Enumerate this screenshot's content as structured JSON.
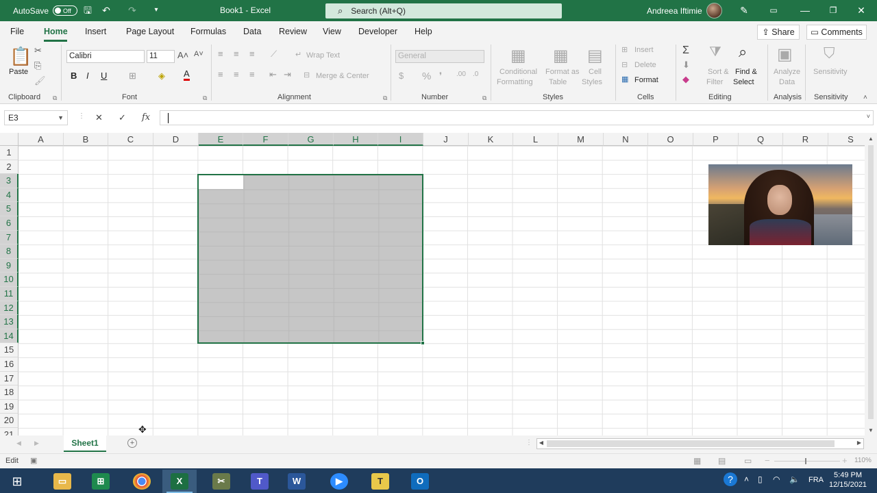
{
  "window": {
    "autosave_label": "AutoSave",
    "autosave_state": "Off",
    "title": "Book1 - Excel",
    "search_placeholder": "Search (Alt+Q)",
    "user_name": "Andreea Iftimie"
  },
  "tabs": [
    "File",
    "Home",
    "Insert",
    "Page Layout",
    "Formulas",
    "Data",
    "Review",
    "View",
    "Developer",
    "Help"
  ],
  "active_tab": "Home",
  "share_label": "Share",
  "comments_label": "Comments",
  "ribbon": {
    "clipboard": {
      "paste": "Paste",
      "label": "Clipboard"
    },
    "font": {
      "name": "Calibri",
      "size": "11",
      "label": "Font",
      "bold": "B",
      "italic": "I",
      "underline": "U"
    },
    "alignment": {
      "wrap_text": "Wrap Text",
      "merge_center": "Merge & Center",
      "label": "Alignment"
    },
    "number": {
      "format": "General",
      "label": "Number",
      "currency": "$",
      "percent": "%"
    },
    "styles": {
      "conditional_1": "Conditional",
      "conditional_2": "Formatting",
      "format_table_1": "Format as",
      "format_table_2": "Table",
      "cell_styles_1": "Cell",
      "cell_styles_2": "Styles",
      "label": "Styles"
    },
    "cells": {
      "insert": "Insert",
      "delete": "Delete",
      "format": "Format",
      "label": "Cells"
    },
    "editing": {
      "sort_1": "Sort &",
      "sort_2": "Filter",
      "find_1": "Find &",
      "find_2": "Select",
      "label": "Editing"
    },
    "analysis": {
      "analyze_1": "Analyze",
      "analyze_2": "Data",
      "label": "Analysis"
    },
    "sensitivity": {
      "button": "Sensitivity",
      "label": "Sensitivity"
    }
  },
  "formula_bar": {
    "name_box": "E3",
    "cancel": "✕",
    "enter": "✓",
    "fx": "fx",
    "value": ""
  },
  "grid": {
    "columns": [
      "A",
      "B",
      "C",
      "D",
      "E",
      "F",
      "G",
      "H",
      "I",
      "J",
      "K",
      "L",
      "M",
      "N",
      "O",
      "P",
      "Q",
      "R",
      "S"
    ],
    "rows": [
      "1",
      "2",
      "3",
      "4",
      "5",
      "6",
      "7",
      "8",
      "9",
      "10",
      "11",
      "12",
      "13",
      "14",
      "15",
      "16",
      "17",
      "18",
      "19",
      "20",
      "21"
    ],
    "selection": "E3:I14",
    "active_cell": "E3"
  },
  "sheets": [
    "Sheet1"
  ],
  "status": {
    "mode": "Edit",
    "zoom": "110%"
  },
  "taskbar": {
    "apps": [
      "File Explorer",
      "Excel Online",
      "Chrome",
      "Excel",
      "Snipping",
      "Teams",
      "Word",
      "Zoom",
      "Text",
      "Outlook"
    ],
    "language": "FRA",
    "time": "5:49 PM",
    "date": "12/15/2021"
  },
  "colors": {
    "excel_green": "#217346",
    "selection_fill": "#c6c6c6",
    "taskbar": "#1f3c5c"
  }
}
